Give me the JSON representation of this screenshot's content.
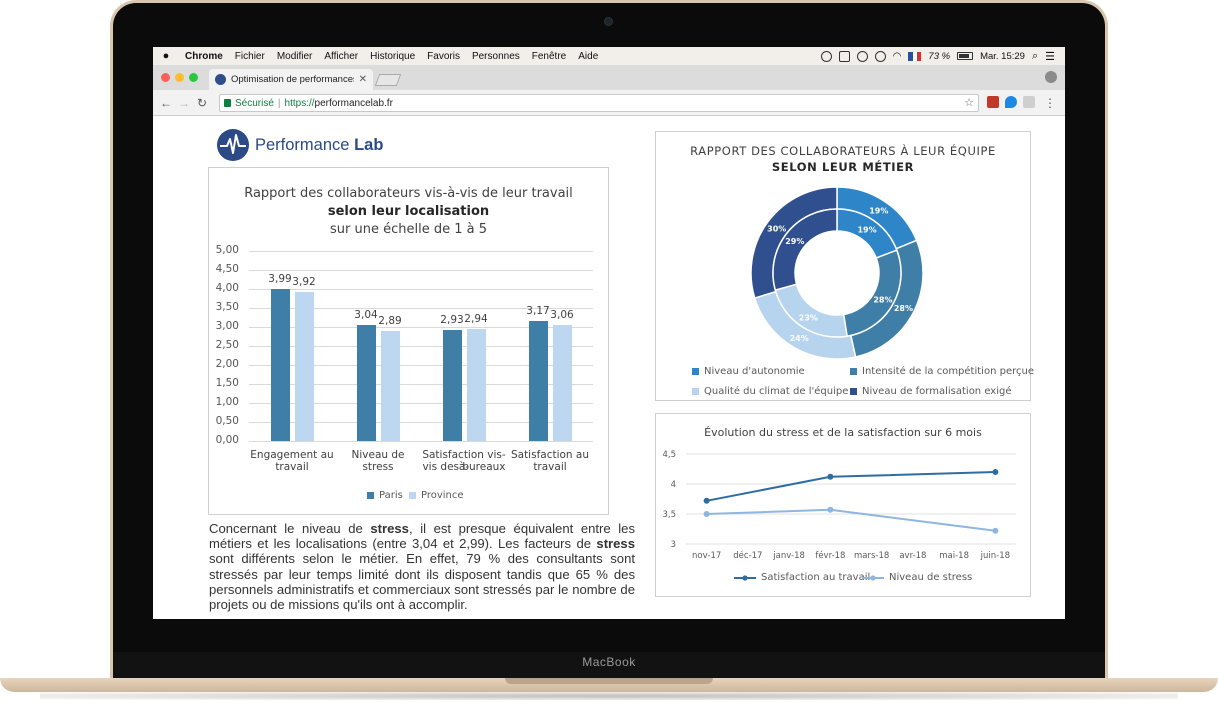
{
  "device": {
    "brand": "MacBook"
  },
  "menubar": {
    "app": "Chrome",
    "items": [
      "Fichier",
      "Modifier",
      "Afficher",
      "Historique",
      "Favoris",
      "Personnes",
      "Fenêtre",
      "Aide"
    ],
    "battery": "73 %",
    "clock": "Mar. 15:29"
  },
  "tab": {
    "title": "Optimisation de performances",
    "close": "✕"
  },
  "address": {
    "secure_label": "Sécurisé",
    "separator": "|",
    "scheme": "https://",
    "host": "performancelab.fr"
  },
  "logo": {
    "name_regular": "Performance",
    "name_bold": "Lab"
  },
  "bar_chart": {
    "title_line1": "Rapport des collaborateurs vis-à-vis de leur travail",
    "title_line2": "selon leur localisation",
    "title_line3": "sur une échelle de 1 à 5",
    "yticks": [
      "5,00",
      "4,50",
      "4,00",
      "3,50",
      "3,00",
      "2,50",
      "2,00",
      "1,50",
      "1,00",
      "0,50",
      "0,00"
    ],
    "categories": [
      {
        "line1": "Engagement au",
        "line2": "travail"
      },
      {
        "line1": "Niveau de stress",
        "line2": ""
      },
      {
        "line1": "Satisfaction vis-à-",
        "line2": "vis des bureaux"
      },
      {
        "line1": "Satisfaction au",
        "line2": "travail"
      }
    ],
    "legend": [
      "Paris",
      "Province"
    ],
    "colors": {
      "paris": "#3f7ea6",
      "province": "#bcd7ef"
    }
  },
  "donut_chart": {
    "title_line1": "RAPPORT DES COLLABORATEURS À LEUR ÉQUIPE",
    "title_line2": "SELON LEUR MÉTIER",
    "legend": [
      "Niveau d'autonomie",
      "Intensité de la compétition perçue",
      "Qualité du climat de l'équipe",
      "Niveau de formalisation exigé"
    ],
    "colors": [
      "#2e86c8",
      "#3f7ea6",
      "#b7d4ee",
      "#304f8f"
    ]
  },
  "line_chart": {
    "title": "Évolution du stress et de la satisfaction sur 6 mois",
    "yticks": [
      "4,5",
      "4",
      "3,5",
      "3"
    ],
    "months": [
      "nov-17",
      "déc-17",
      "janv-18",
      "févr-18",
      "mars-18",
      "avr-18",
      "mai-18",
      "juin-18"
    ],
    "legend": [
      "Satisfaction au travail",
      "Niveau de stress"
    ],
    "colors": {
      "satisfaction": "#2f6da0",
      "stress": "#8fb6e0"
    }
  },
  "chart_data": [
    {
      "type": "bar",
      "title": "Rapport des collaborateurs vis-à-vis de leur travail selon leur localisation sur une échelle de 1 à 5",
      "categories": [
        "Engagement au travail",
        "Niveau de stress",
        "Satisfaction vis-à-vis des bureaux",
        "Satisfaction au travail"
      ],
      "series": [
        {
          "name": "Paris",
          "values": [
            3.99,
            3.04,
            2.93,
            3.17
          ],
          "labels": [
            "3,99",
            "3,04",
            "2,93",
            "3,17"
          ]
        },
        {
          "name": "Province",
          "values": [
            3.92,
            2.89,
            2.94,
            3.06
          ],
          "labels": [
            "3,92",
            "2,89",
            "2,94",
            "3,06"
          ]
        }
      ],
      "ylim": [
        0,
        5
      ],
      "grid": true,
      "legend_position": "bottom"
    },
    {
      "type": "pie",
      "title": "RAPPORT DES COLLABORATEURS À LEUR ÉQUIPE SELON LEUR MÉTIER",
      "categories": [
        "Niveau d'autonomie",
        "Intensité de la compétition perçue",
        "Qualité du climat de l'équipe",
        "Niveau de formalisation exigé"
      ],
      "series": [
        {
          "values": [
            19,
            28,
            24,
            30
          ],
          "labels": [
            "19%",
            "28%",
            "24%",
            "30%"
          ]
        },
        {
          "values": [
            19,
            28,
            23,
            29
          ],
          "labels": [
            "19%",
            "28%",
            "23%",
            "29%"
          ]
        }
      ],
      "legend_position": "bottom"
    },
    {
      "type": "line",
      "title": "Évolution du stress et de la satisfaction sur 6 mois",
      "x": [
        "nov-17",
        "déc-17",
        "janv-18",
        "févr-18",
        "mars-18",
        "avr-18",
        "mai-18",
        "juin-18"
      ],
      "series": [
        {
          "name": "Satisfaction au travail",
          "points": [
            [
              "nov-17",
              3.72
            ],
            [
              "févr-18",
              4.12
            ],
            [
              "juin-18",
              4.2
            ]
          ]
        },
        {
          "name": "Niveau de stress",
          "points": [
            [
              "nov-17",
              3.5
            ],
            [
              "févr-18",
              3.57
            ],
            [
              "juin-18",
              3.22
            ]
          ]
        }
      ],
      "ylim": [
        3,
        4.5
      ],
      "grid": true,
      "legend_position": "bottom"
    }
  ],
  "paragraph": {
    "p1": "Concernant le niveau de ",
    "b1": "stress",
    "p2": ", il est presque équivalent entre les métiers et les localisations (entre 3,04 et 2,99). Les facteurs de ",
    "b2": "stress",
    "p3": " sont différents selon le métier. En effet, 79 % des consultants sont stressés par leur temps limité dont ils disposent tandis que 65 % des personnels administratifs et commerciaux sont stressés par le nombre de projets ou de missions qu'ils ont à accomplir."
  }
}
